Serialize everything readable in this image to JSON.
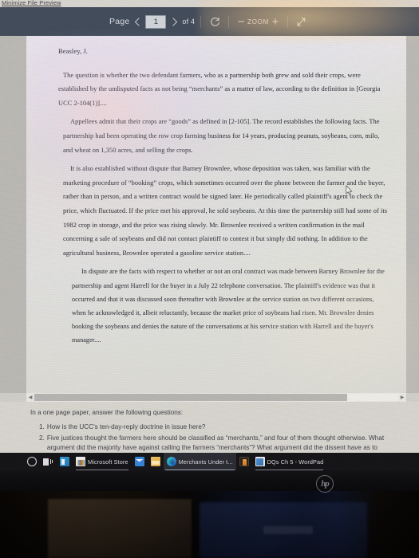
{
  "window": {
    "minimize_link": "Minimize File Preview"
  },
  "toolbar": {
    "page_label": "Page",
    "prev_icon": "chevron-left-icon",
    "page_value": "1",
    "next_icon": "chevron-right-icon",
    "of_label": "of 4",
    "rotate_icon": "rotate-icon",
    "zoom_out_label": "−",
    "zoom_label": "ZOOM",
    "zoom_in_label": "+",
    "expand_icon": "expand-arrows-icon",
    "background_color": "#3b4553"
  },
  "document": {
    "byline": "Beasley, J.",
    "paragraphs": [
      "The question is whether the two defendant farmers, who as a partnership both grew and sold their crops, were established by the undisputed facts as not being “merchants” as a matter of law, according to the definition in [Georgia UCC 2-104(1)]....",
      "Appellees admit that their crops are “goods” as defined in [2-105]. The record establishes the following facts. The partnership had been operating the row crop farming business for 14 years, producing peanuts, soybeans, corn, milo, and wheat on 1,350 acres, and selling the crops.",
      "It is also established without dispute that Barney Brownlee, whose deposition was taken, was familiar with the marketing procedure of “booking” crops, which sometimes occurred over the phone between the farmer and the buyer, rather than in person, and a written contract would be signed later. He periodically called plaintiff's agent to check the price, which fluctuated. If the price met his approval, he sold soybeans. At this time the partnership still had some of its 1982 crop in storage, and the price was rising slowly. Mr. Brownlee received a written confirmation in the mail concerning a sale of soybeans and did not contact plaintiff to contest it but simply did nothing. In addition to the agricultural business, Brownlee operated a gasoline service station....",
      "In dispute are the facts with respect to whether or not an oral contract was made between Barney Brownlee for the partnership and agent Harrell for the buyer in a July 22 telephone conversation. The plaintiff's evidence was that it occurred and that it was discussed soon thereafter with Brownlee at the service station on two different occasions, when he acknowledged it, albeit reluctantly, because the market price of soybeans had risen. Mr. Brownlee denies booking the soybeans and denies the nature of the conversations at his service station with Harrell and the buyer's manager...."
    ]
  },
  "assignment": {
    "intro": "In a one page paper, answer the following questions:",
    "questions": [
      {
        "number": "1.",
        "text": "How is the UCC's ten-day-reply doctrine in issue here?"
      },
      {
        "number": "2.",
        "text": "Five justices thought the farmers here should be classified as “merchants,” and four of them thought otherwise. What argument did the majority have against calling the farmers “merchants”? What argument did the dissent have as to"
      }
    ]
  },
  "taskbar": {
    "items": [
      {
        "icon": "cortana-circle-icon",
        "label": ""
      },
      {
        "icon": "task-view-icon",
        "label": ""
      },
      {
        "icon": "blue-app-icon",
        "label": ""
      },
      {
        "icon": "microsoft-store-icon",
        "label": "Microsoft Store"
      },
      {
        "icon": "mail-icon",
        "label": ""
      },
      {
        "icon": "file-explorer-icon",
        "label": ""
      },
      {
        "icon": "edge-icon",
        "label": "Merchants Under t..."
      },
      {
        "icon": "orange-app-icon",
        "label": ""
      },
      {
        "icon": "wordpad-icon",
        "label": "DQs Ch 5 - WordPad"
      }
    ]
  },
  "device": {
    "brand_logo": "hp"
  }
}
